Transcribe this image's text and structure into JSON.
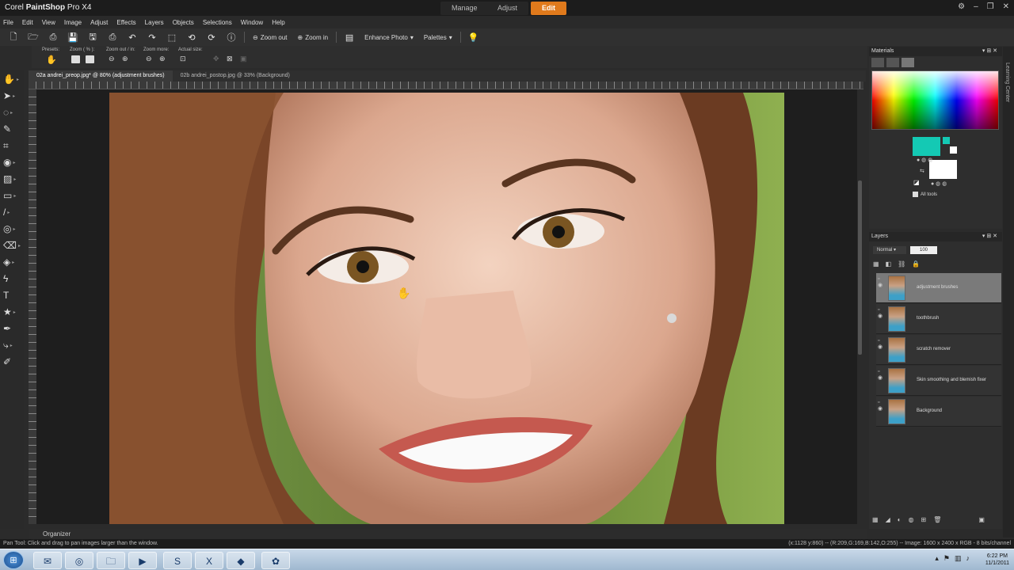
{
  "app": {
    "brand": "Corel",
    "name": "PaintShop",
    "suffix": "Pro X4"
  },
  "workspaces": [
    {
      "label": "Manage"
    },
    {
      "label": "Adjust"
    },
    {
      "label": "Edit"
    }
  ],
  "menus": [
    "File",
    "Edit",
    "View",
    "Image",
    "Adjust",
    "Effects",
    "Layers",
    "Objects",
    "Selections",
    "Window",
    "Help"
  ],
  "toolbar": {
    "zoom_out": "Zoom out",
    "zoom_in": "Zoom in",
    "enhance": "Enhance Photo",
    "palettes": "Palettes"
  },
  "options": {
    "presets": "Presets:",
    "zoom_pct": "Zoom ( % ):",
    "zoom_outin": "Zoom out / in:",
    "zoom_more": "Zoom more:",
    "actual": "Actual size:"
  },
  "doc_tabs": [
    {
      "label": "02a andrei_preop.jpg* @ 80% (adjustment brushes)"
    },
    {
      "label": "02b andrei_postop.jpg @ 33% (Background)"
    }
  ],
  "panels": {
    "materials": "Materials",
    "layers": "Layers",
    "all_tools": "All tools",
    "blend": "Normal",
    "opacity": "100",
    "learning": "Learning Center"
  },
  "layers": [
    {
      "name": "adjustment brushes",
      "selected": true
    },
    {
      "name": "toothbrush",
      "selected": false
    },
    {
      "name": "scratch remover",
      "selected": false
    },
    {
      "name": "Skin smoothing and blemish fixer",
      "selected": false
    },
    {
      "name": "Background",
      "selected": false
    }
  ],
  "organizer": "Organizer",
  "status": {
    "left": "Pan Tool: Click and drag to pan images larger than the window.",
    "right": "(x:1128 y:860) -- (R:209,G:169,B:142,O:255) -- Image: 1600 x 2400 x RGB - 8 bits/channel"
  },
  "colors": {
    "foreground": "#14c9b4",
    "background": "#ffffff",
    "accent": "#e07a1c"
  },
  "clock": {
    "time": "6:22 PM",
    "date": "11/1/2011"
  }
}
